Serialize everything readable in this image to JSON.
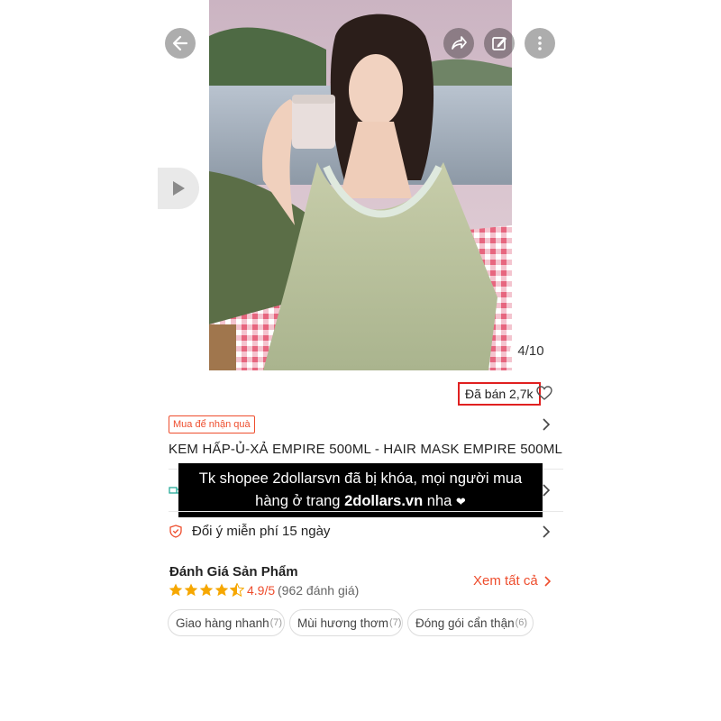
{
  "gallery": {
    "counter": "4/10"
  },
  "product": {
    "sold_label": "Đã bán 2,7k",
    "promo_tag": "Mua để nhận quà",
    "title": "KEM HẤP-Ủ-XẢ EMPIRE 500ML - HAIR MASK EMPIRE 500ML"
  },
  "banner": {
    "line1": "Tk shopee 2dollarsvn đã bị khóa, mọi người mua",
    "line2_prefix": "hàng ở trang ",
    "line2_bold": "2dollars.vn",
    "line2_suffix": " nha",
    "heart": "❤"
  },
  "policy": {
    "return_label": "Đổi ý miễn phí 15 ngày"
  },
  "reviews": {
    "section_title": "Đánh Giá Sản Phẩm",
    "rating": "4.9/5",
    "rating_count": "(962 đánh giá)",
    "stars": 4.5,
    "see_all": "Xem tất cả",
    "chips": [
      {
        "label": "Giao hàng nhanh",
        "count": "(7)"
      },
      {
        "label": "Mùi hương thơm",
        "count": "(7)"
      },
      {
        "label": "Đóng gói cẩn thận",
        "count": "(6)"
      }
    ]
  },
  "colors": {
    "accent": "#ee4d2d",
    "star": "#f6a700",
    "highlight_border": "#e02020",
    "banner_bg": "#000000"
  },
  "icons": [
    "back-arrow-icon",
    "share-icon",
    "edit-icon",
    "more-icon",
    "play-icon",
    "heart-icon",
    "chevron-right-icon",
    "truck-icon",
    "shield-icon",
    "star-icon"
  ]
}
